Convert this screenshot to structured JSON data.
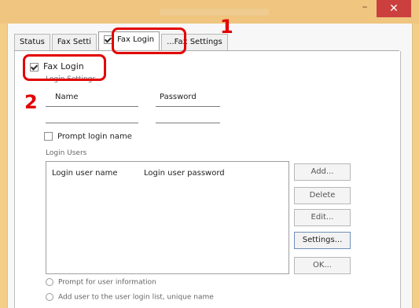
{
  "window": {
    "title": "",
    "close_glyph": "✕",
    "minimize_glyph": "–"
  },
  "tabs": [
    {
      "label": "Status"
    },
    {
      "label": "Fax Setti"
    },
    {
      "label": "Fax Login"
    },
    {
      "label": "...Fax Settings"
    }
  ],
  "panel": {
    "checkbox_label": "Fax Login",
    "caption": "Login Settings",
    "fields": [
      {
        "label": "Name"
      },
      {
        "label": "Password"
      }
    ],
    "option_label": "Prompt login name",
    "list_caption": "Login Users",
    "list_rows": [
      {
        "col1": "Login user name",
        "col2": "Login user password"
      }
    ],
    "buttons": [
      {
        "label": "Add..."
      },
      {
        "label": "Delete"
      },
      {
        "label": "Edit..."
      },
      {
        "label": "Settings..."
      },
      {
        "label": "OK..."
      }
    ],
    "bottom_options": [
      {
        "label": "Prompt for user information"
      },
      {
        "label": "Add user to the user login list, unique name"
      }
    ]
  },
  "annotations": {
    "callout_1": "1",
    "callout_2": "2"
  }
}
